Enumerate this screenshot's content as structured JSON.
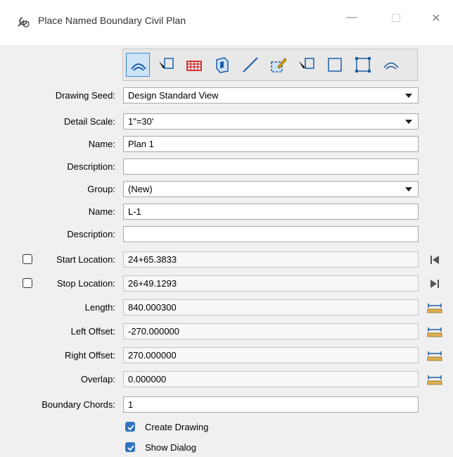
{
  "window": {
    "title": "Place Named Boundary Civil Plan"
  },
  "toolbar": {
    "tools": [
      "civil-plan-boundary-icon",
      "select-element-icon",
      "grid-sheet-icon",
      "3d-view-icon",
      "line-icon",
      "edit-rectangle-icon",
      "select-pointer-icon",
      "rectangle-icon",
      "shape-icon",
      "civil-profile-boundary-icon"
    ],
    "active_index": 0
  },
  "form": {
    "drawing_seed": {
      "label": "Drawing Seed:",
      "value": "Design Standard View"
    },
    "detail_scale": {
      "label": "Detail Scale:",
      "value": "1\"=30'"
    },
    "name": {
      "label": "Name:",
      "value": "Plan 1"
    },
    "description": {
      "label": "Description:",
      "value": ""
    },
    "group": {
      "label": "Group:",
      "value": "(New)"
    },
    "group_name": {
      "label": "Name:",
      "value": "L-1"
    },
    "group_description": {
      "label": "Description:",
      "value": ""
    },
    "start_location": {
      "label": "Start Location:",
      "value": "24+65.3833",
      "checked": false
    },
    "stop_location": {
      "label": "Stop Location:",
      "value": "26+49.1293",
      "checked": false
    },
    "length": {
      "label": "Length:",
      "value": "840.000300"
    },
    "left_offset": {
      "label": "Left Offset:",
      "value": "-270.000000"
    },
    "right_offset": {
      "label": "Right Offset:",
      "value": "270.000000"
    },
    "overlap": {
      "label": "Overlap:",
      "value": "0.000000"
    },
    "boundary_chords": {
      "label": "Boundary Chords:",
      "value": "1"
    },
    "create_drawing": {
      "label": "Create Drawing",
      "checked": true
    },
    "show_dialog": {
      "label": "Show Dialog",
      "checked": true
    }
  },
  "colors": {
    "accent": "#2f74c0",
    "active_tool_bg": "#cde4f7"
  }
}
